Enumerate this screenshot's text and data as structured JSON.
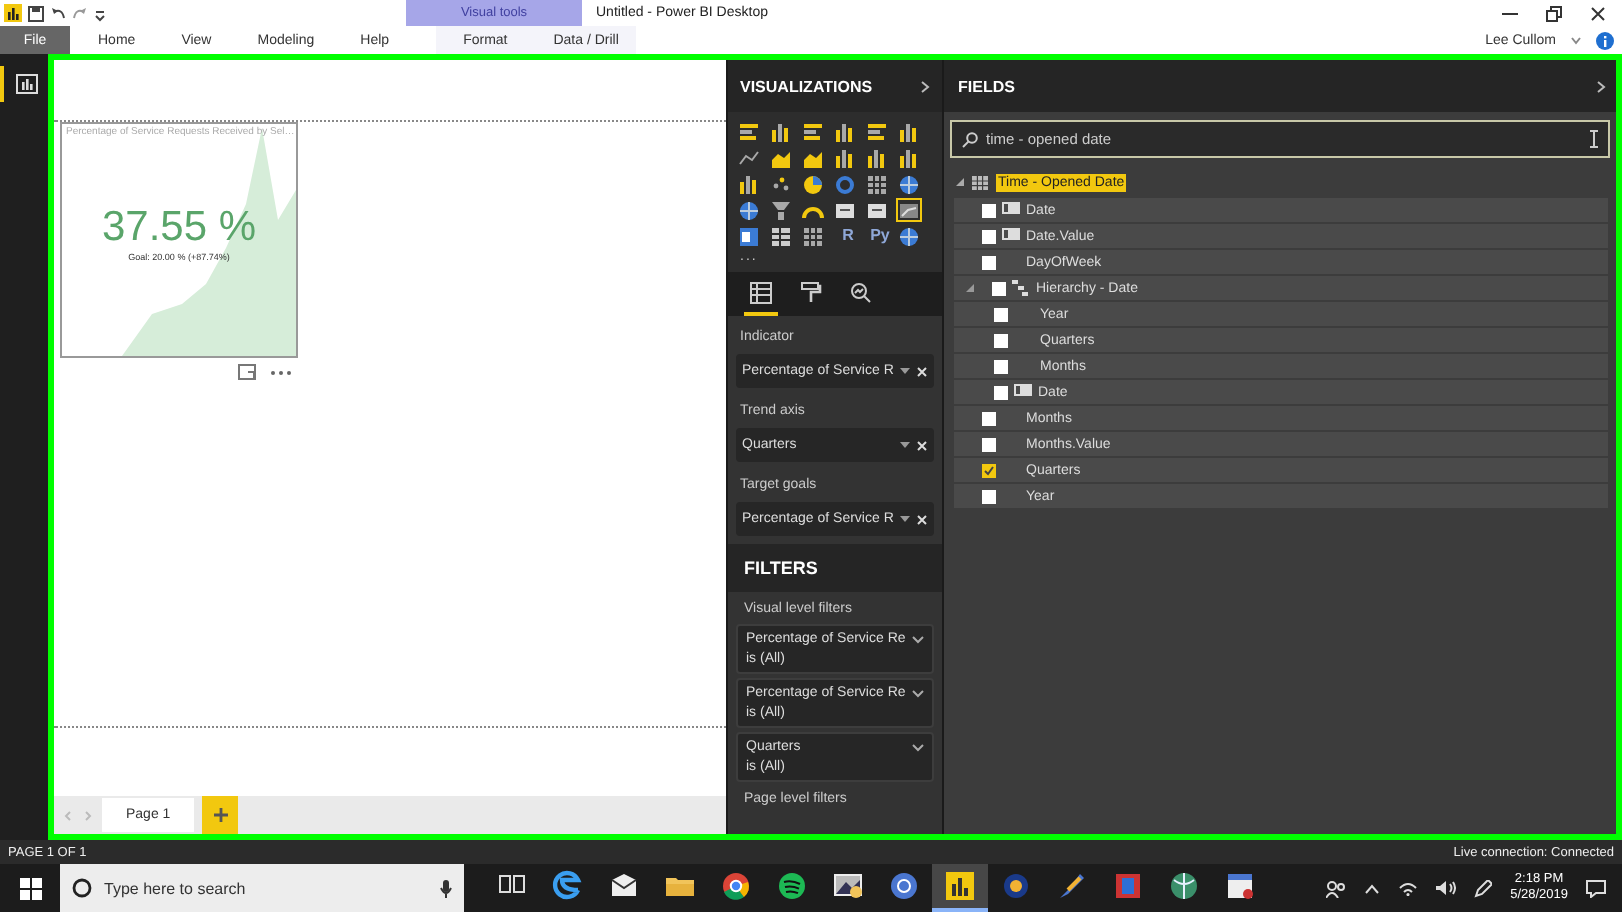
{
  "title_bar": {
    "context_label": "Visual tools",
    "title": "Untitled - Power BI Desktop"
  },
  "ribbon_tabs": [
    {
      "label": "File",
      "kind": "file"
    },
    {
      "label": "Home",
      "kind": "tab"
    },
    {
      "label": "View",
      "kind": "tab"
    },
    {
      "label": "Modeling",
      "kind": "tab"
    },
    {
      "label": "Help",
      "kind": "tab"
    },
    {
      "label": "Format",
      "kind": "context"
    },
    {
      "label": "Data / Drill",
      "kind": "context"
    }
  ],
  "user": "Lee Cullom",
  "visual": {
    "title": "Percentage of Service Requests Received by Sel…",
    "value": "37.55 %",
    "goal": "Goal: 20.00 % (+87.74%)"
  },
  "visualizations": {
    "title": "VISUALIZATIONS",
    "visual_types": [
      {
        "kind": "bar",
        "selected": false
      },
      {
        "kind": "column",
        "selected": false
      },
      {
        "kind": "bar",
        "selected": false
      },
      {
        "kind": "column",
        "selected": false
      },
      {
        "kind": "bar",
        "selected": false
      },
      {
        "kind": "column",
        "selected": false
      },
      {
        "kind": "line",
        "selected": false
      },
      {
        "kind": "area",
        "selected": false
      },
      {
        "kind": "area",
        "selected": false
      },
      {
        "kind": "column",
        "selected": false
      },
      {
        "kind": "column",
        "selected": false
      },
      {
        "kind": "column",
        "selected": false
      },
      {
        "kind": "column",
        "selected": false
      },
      {
        "kind": "scatter",
        "selected": false
      },
      {
        "kind": "pie",
        "selected": false
      },
      {
        "kind": "donut",
        "selected": false
      },
      {
        "kind": "matrix",
        "selected": false
      },
      {
        "kind": "globe",
        "selected": false
      },
      {
        "kind": "globe",
        "selected": false
      },
      {
        "kind": "funnel",
        "selected": false
      },
      {
        "kind": "gauge",
        "selected": false
      },
      {
        "kind": "card",
        "selected": false
      },
      {
        "kind": "card",
        "selected": false
      },
      {
        "kind": "kpi",
        "selected": true
      },
      {
        "kind": "slicer",
        "selected": false
      },
      {
        "kind": "table",
        "selected": false
      },
      {
        "kind": "matrix",
        "selected": false
      },
      {
        "kind": "text",
        "label": "R",
        "selected": false
      },
      {
        "kind": "text",
        "label": "Py",
        "selected": false
      },
      {
        "kind": "globe",
        "selected": false
      }
    ],
    "more": "...",
    "pane_tabs": [
      {
        "kind": "fields",
        "selected": true
      },
      {
        "kind": "format",
        "selected": false
      },
      {
        "kind": "analytics",
        "selected": false
      }
    ],
    "wells": [
      {
        "label": "Indicator",
        "field": "Percentage of Service R"
      },
      {
        "label": "Trend axis",
        "field": "Quarters"
      },
      {
        "label": "Target goals",
        "field": "Percentage of Service R"
      }
    ]
  },
  "filters": {
    "title": "FILTERS",
    "visual_level": "Visual level filters",
    "items": [
      {
        "name": "Percentage of Service Re",
        "condition": "is (All)"
      },
      {
        "name": "Percentage of Service Re",
        "condition": "is (All)"
      },
      {
        "name": "Quarters",
        "condition": "is (All)"
      }
    ],
    "page_level": "Page level filters"
  },
  "fields": {
    "title": "FIELDS",
    "search": "time - opened date",
    "table": {
      "name": "Time - Opened Date",
      "expanded": true,
      "items": [
        {
          "name": "Date",
          "kind": "date",
          "checked": false
        },
        {
          "name": "Date.Value",
          "kind": "date",
          "checked": false
        },
        {
          "name": "DayOfWeek",
          "kind": "field",
          "checked": false
        },
        {
          "name": "Hierarchy - Date",
          "kind": "hierarchy",
          "checked": false,
          "expanded": true,
          "children": [
            {
              "name": "Year",
              "kind": "field",
              "checked": false
            },
            {
              "name": "Quarters",
              "kind": "field",
              "checked": false
            },
            {
              "name": "Months",
              "kind": "field",
              "checked": false
            },
            {
              "name": "Date",
              "kind": "date",
              "checked": false
            }
          ]
        },
        {
          "name": "Months",
          "kind": "field",
          "checked": false
        },
        {
          "name": "Months.Value",
          "kind": "field",
          "checked": false
        },
        {
          "name": "Quarters",
          "kind": "field",
          "checked": true
        },
        {
          "name": "Year",
          "kind": "field",
          "checked": false
        }
      ]
    }
  },
  "page_tabs": [
    {
      "label": "Page 1",
      "selected": true
    }
  ],
  "status_bar": {
    "page": "PAGE 1 OF 1",
    "connection": "Live connection: Connected"
  },
  "taskbar": {
    "search_placeholder": "Type here to search",
    "apps": [
      {
        "kind": "taskview",
        "selected": false
      },
      {
        "kind": "edge",
        "selected": false
      },
      {
        "kind": "mail",
        "selected": false
      },
      {
        "kind": "folder",
        "selected": false
      },
      {
        "kind": "chrome",
        "selected": false
      },
      {
        "kind": "music",
        "selected": false
      },
      {
        "kind": "image",
        "selected": false
      },
      {
        "kind": "bluecircle",
        "selected": false
      },
      {
        "kind": "powerbi",
        "selected": true
      },
      {
        "kind": "disc",
        "selected": false
      },
      {
        "kind": "rocket",
        "selected": false
      },
      {
        "kind": "code",
        "selected": false
      },
      {
        "kind": "globe",
        "selected": false
      },
      {
        "kind": "window",
        "selected": false
      }
    ],
    "time": "2:18 PM",
    "date": "5/28/2019"
  }
}
